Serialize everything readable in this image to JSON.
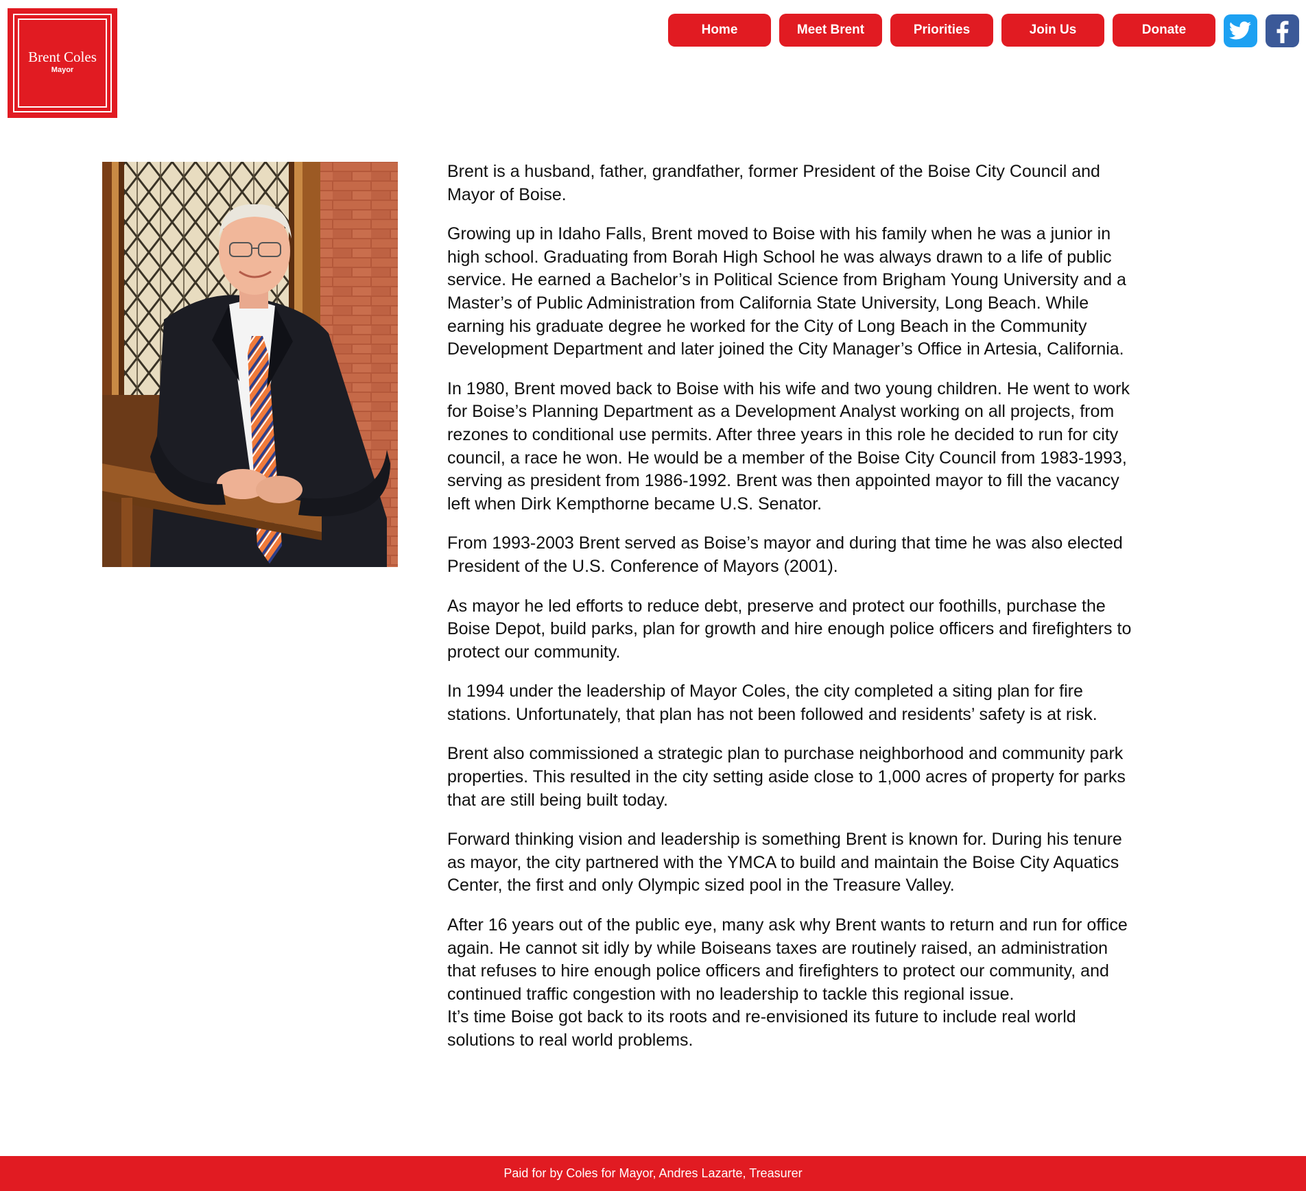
{
  "logo": {
    "name": "Brent Coles",
    "subtitle": "Mayor"
  },
  "nav": {
    "items": [
      {
        "label": "Home"
      },
      {
        "label": "Meet Brent"
      },
      {
        "label": "Priorities"
      },
      {
        "label": "Join Us"
      },
      {
        "label": "Donate"
      }
    ],
    "social": [
      {
        "icon": "twitter-icon",
        "color": "#1da1f2"
      },
      {
        "icon": "facebook-icon",
        "color": "#3b5998"
      }
    ]
  },
  "colors": {
    "brand_red": "#e11b22",
    "text": "#111111",
    "background": "#ffffff"
  },
  "bio": {
    "paragraphs": [
      "Brent is a husband, father, grandfather, former President of the Boise City Council and Mayor of Boise.",
      "Growing up in Idaho Falls, Brent moved to Boise with his family when he was a junior in high school. Graduating from Borah High School he was always drawn to a life of public service. He earned a Bachelor’s in Political Science from Brigham Young University and a Master’s of Public Administration from California State University, Long Beach. While earning his graduate degree he worked for the City of Long Beach in the Community Development Department and later joined the City Manager’s Office in Artesia, California.",
      "In 1980, Brent moved back to Boise with his wife and two young children. He went to work for Boise’s Planning Department as a Development Analyst working on all projects, from rezones to conditional use permits. After three years in this role he decided to run for city council, a race he won. He would be a member of the Boise City Council from 1983-1993, serving as president from 1986-1992. Brent was then appointed mayor to fill the vacancy left when Dirk Kempthorne became U.S. Senator.",
      "From 1993-2003 Brent served as Boise’s mayor and during that time he was also elected President of the U.S. Conference of Mayors (2001).",
      "As mayor he led efforts to reduce debt, preserve and protect our foothills, purchase the Boise Depot, build parks, plan for growth and hire enough police officers and firefighters to protect our community.",
      "In 1994 under the leadership of Mayor Coles, the city completed a siting plan for fire stations. Unfortunately, that plan has not been followed and residents’ safety is at risk.",
      "Brent also commissioned a strategic plan to purchase neighborhood and community park properties. This resulted in the city setting aside close to 1,000 acres of property for parks that are still being built today.",
      "Forward thinking vision and leadership is something Brent is known for. During his tenure as mayor, the city partnered with the YMCA to build and maintain the Boise City Aquatics Center, the first and only Olympic sized pool in the Treasure Valley.",
      "After 16 years out of the public eye, many ask why Brent wants to return and run for office again. He cannot sit idly by while Boiseans taxes are routinely raised, an administration that refuses to hire enough police officers and firefighters to protect our community, and continued traffic congestion with no leadership to tackle this regional issue.",
      "It’s time Boise got back to its roots and re-envisioned its future to include real world solutions to real world problems."
    ]
  },
  "footer": {
    "text": "Paid for by Coles for Mayor, Andres Lazarte, Treasurer"
  }
}
